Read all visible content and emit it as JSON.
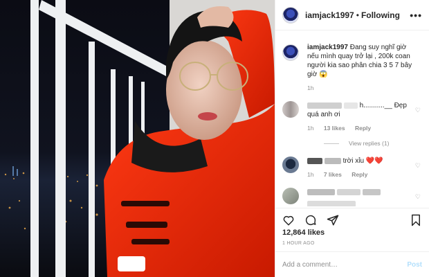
{
  "header": {
    "username": "iamjack1997",
    "separator": "•",
    "follow_label": "Following",
    "more": "•••"
  },
  "caption": {
    "username": "iamjack1997",
    "text": "Đang suy nghĩ giờ nếu mình quay trở lại , 200k coan người kia sao phân chia 3 5 7 bây giờ 😱",
    "time": "1h"
  },
  "comments": [
    {
      "text_visible": "h...........__ Đẹp quá anh ơi",
      "time": "1h",
      "likes": "13 likes",
      "reply": "Reply"
    },
    {
      "text_visible": "trời xỉu ❤️❤️",
      "time": "1h",
      "likes": "7 likes",
      "reply": "Reply"
    },
    {
      "text_visible": ""
    }
  ],
  "view_replies": "View replies (1)",
  "likes_count": "12,864 likes",
  "time_ago": "1 HOUR AGO",
  "add_comment": {
    "placeholder": "Add a comment…",
    "post_label": "Post"
  },
  "icons": [
    "heart-icon",
    "comment-icon",
    "share-icon",
    "bookmark-icon",
    "more-icon"
  ]
}
